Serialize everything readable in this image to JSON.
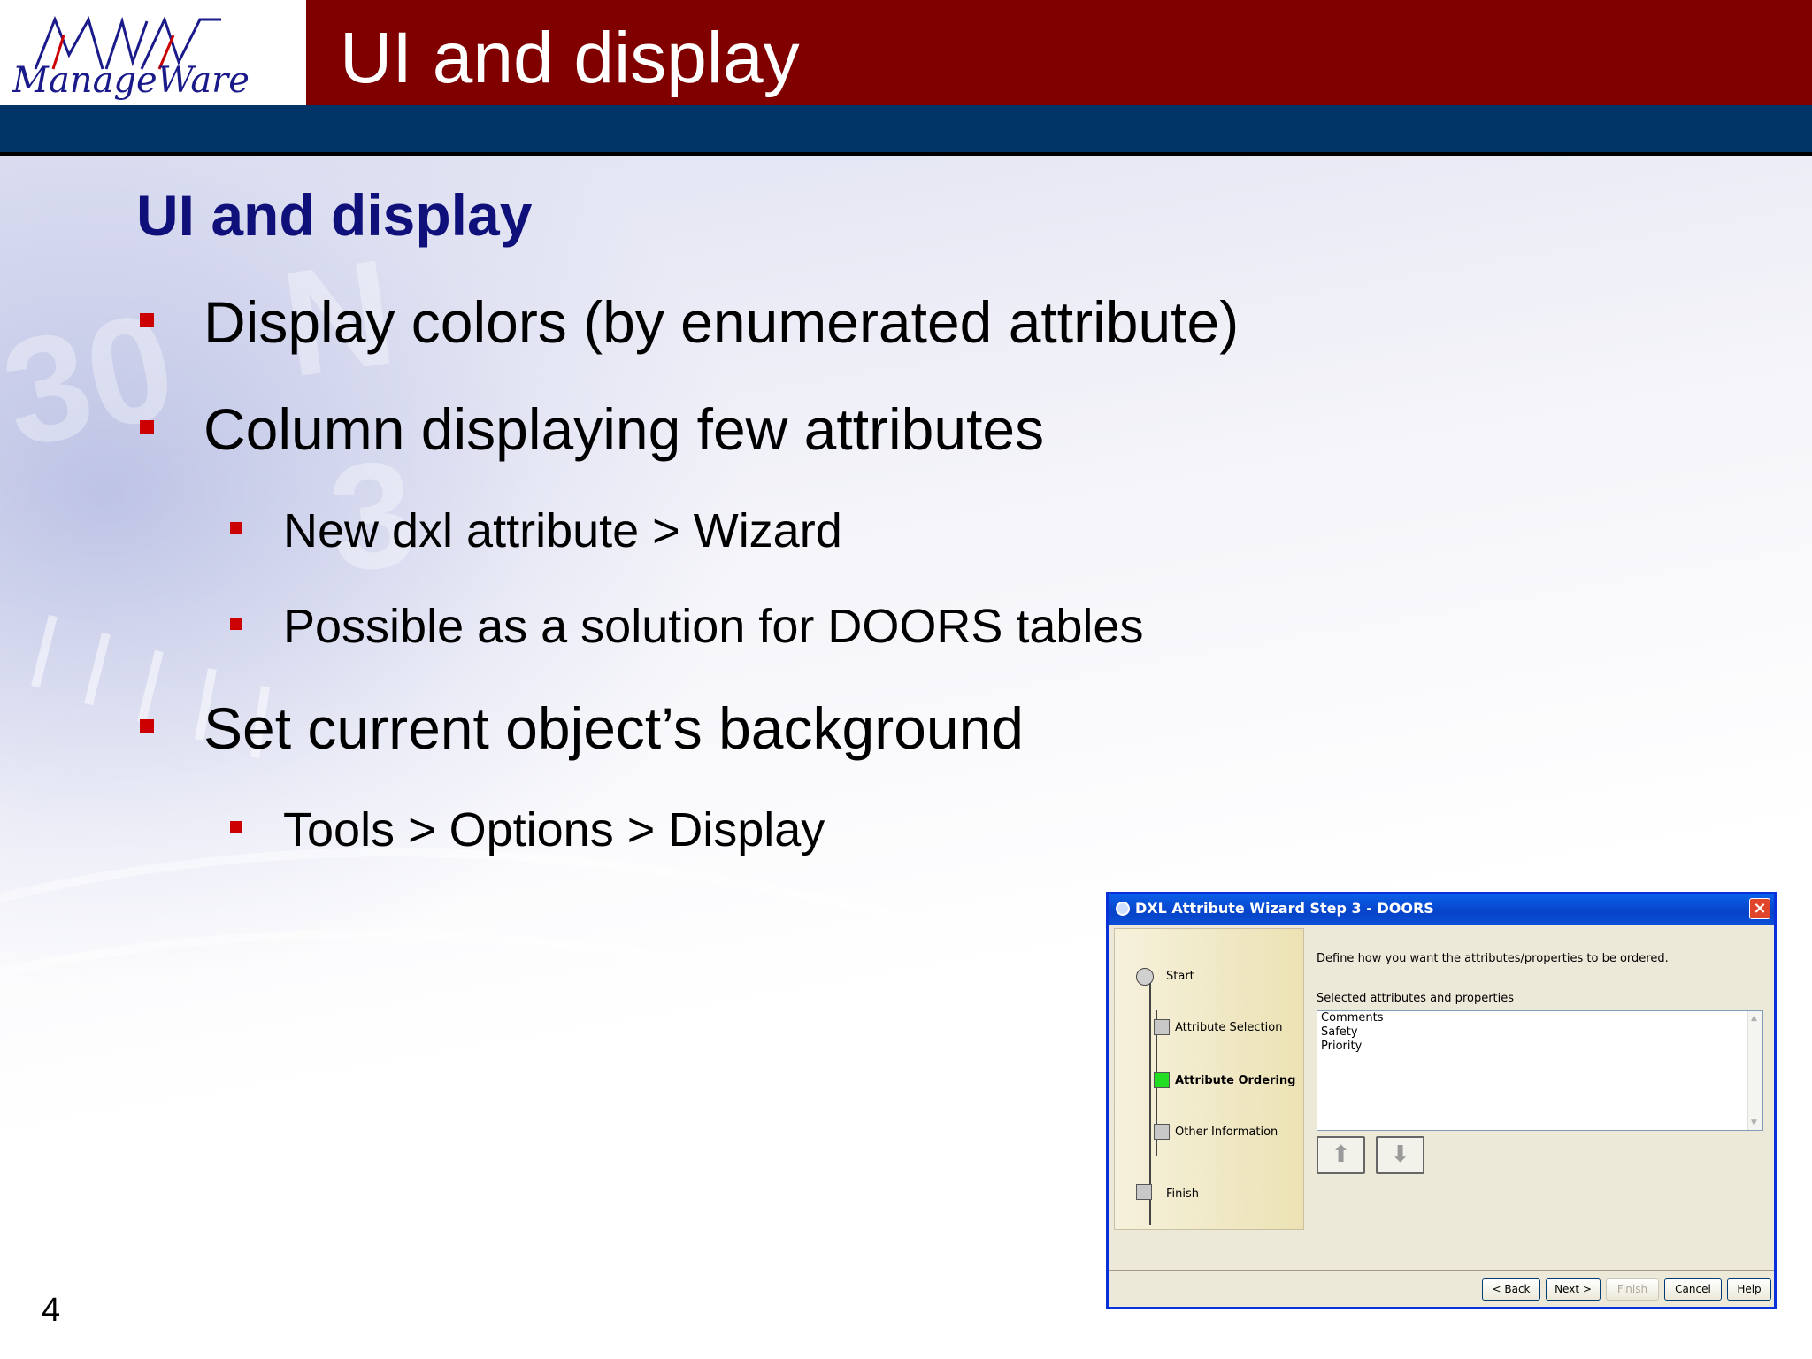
{
  "logo": {
    "text": "ManageWare"
  },
  "header": {
    "title": "UI and display"
  },
  "slide": {
    "heading": "UI and display",
    "bullets": [
      "Display colors (by enumerated attribute)",
      "Column displaying few attributes",
      "New dxl attribute > Wizard",
      "Possible as a solution for DOORS tables",
      "Set current object’s background",
      "Tools > Options > Display"
    ],
    "page_number": "4"
  },
  "dialog": {
    "title": "DXL Attribute Wizard  Step 3 - DOORS",
    "steps": [
      "Start",
      "Attribute Selection",
      "Attribute Ordering",
      "Other Information",
      "Finish"
    ],
    "active_step": "Attribute Ordering",
    "instruction": "Define how you want the attributes/properties to be ordered.",
    "list_label": "Selected attributes and properties",
    "list_items": [
      "Comments",
      "Safety",
      "Priority"
    ],
    "buttons": {
      "back": "< Back",
      "next": "Next >",
      "finish": "Finish",
      "cancel": "Cancel",
      "help": "Help"
    }
  },
  "colors": {
    "title_bar": "#800000",
    "blue_band": "#003366",
    "heading": "#10107a",
    "bullet": "#cc0000"
  }
}
